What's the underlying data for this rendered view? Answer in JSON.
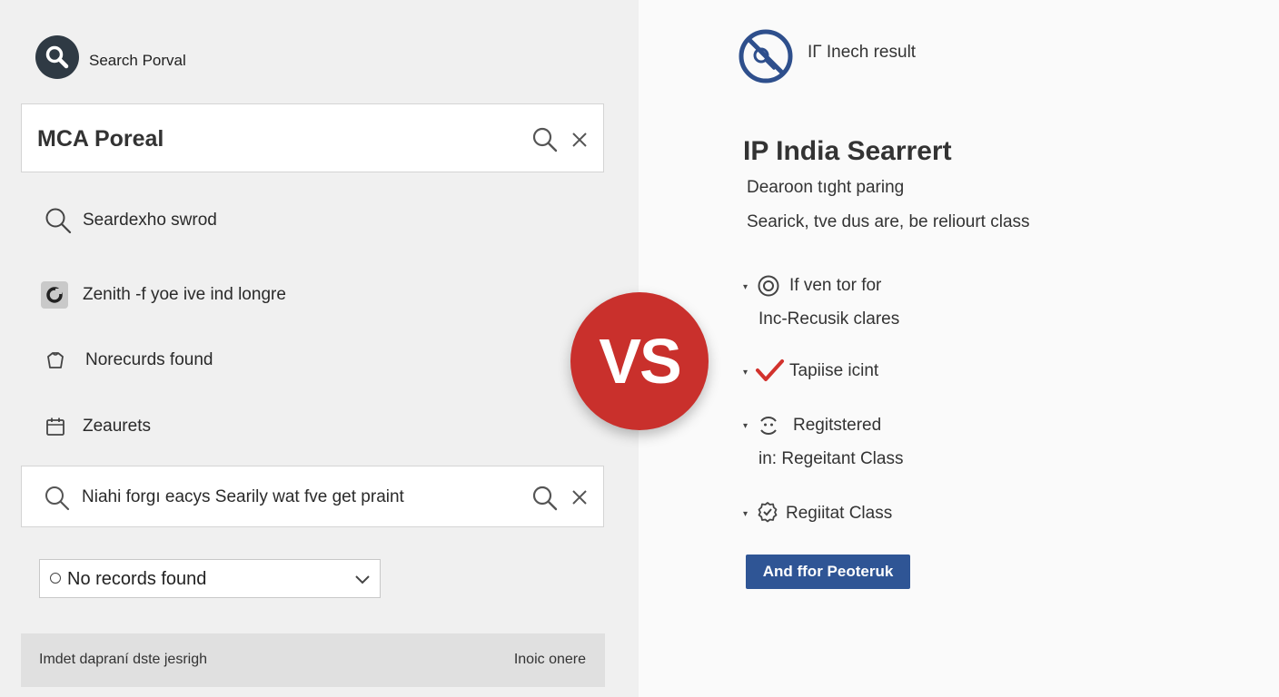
{
  "left": {
    "header_title": "Search Porval",
    "search_value": "MCA Poreal",
    "items": [
      {
        "label": "Seardexho swrod",
        "icon": "search-icon"
      },
      {
        "label": "Zenith -f yoe ive ind longre",
        "icon": "square-logo-icon"
      },
      {
        "label": "Norecurds found",
        "icon": "tag-icon"
      },
      {
        "label": "Zeaurets",
        "icon": "calendar-icon"
      }
    ],
    "second_search_text": "Niahi forgı eacys Searily wat fve get praint",
    "dropdown_value": "No records found",
    "footer_left": "Imdet dapraní dste jesrigh",
    "footer_right": "Inoic onere"
  },
  "vs_label": "VS",
  "right": {
    "header_title": "IГ Inech result",
    "title": "IP India Searrert",
    "subtitle1": "Dearoon tıght  paring",
    "subtitle2": "Searick, tve dus are, be reliourt class",
    "item1_label": "If ven tor for",
    "item1_sub": "Inc-Recusik clares",
    "item2_label": "Tapiise icint",
    "item3_label": "Regitstered",
    "item3_sub": "in: Regeitant Class",
    "item4_label": "Regiitat Class",
    "button_label": "And ffor Peoteruk"
  },
  "colors": {
    "vs_red": "#c9302c",
    "accent_blue": "#2f5595",
    "check_red": "#d2322d",
    "no_icon_blue": "#2e4f8c"
  }
}
